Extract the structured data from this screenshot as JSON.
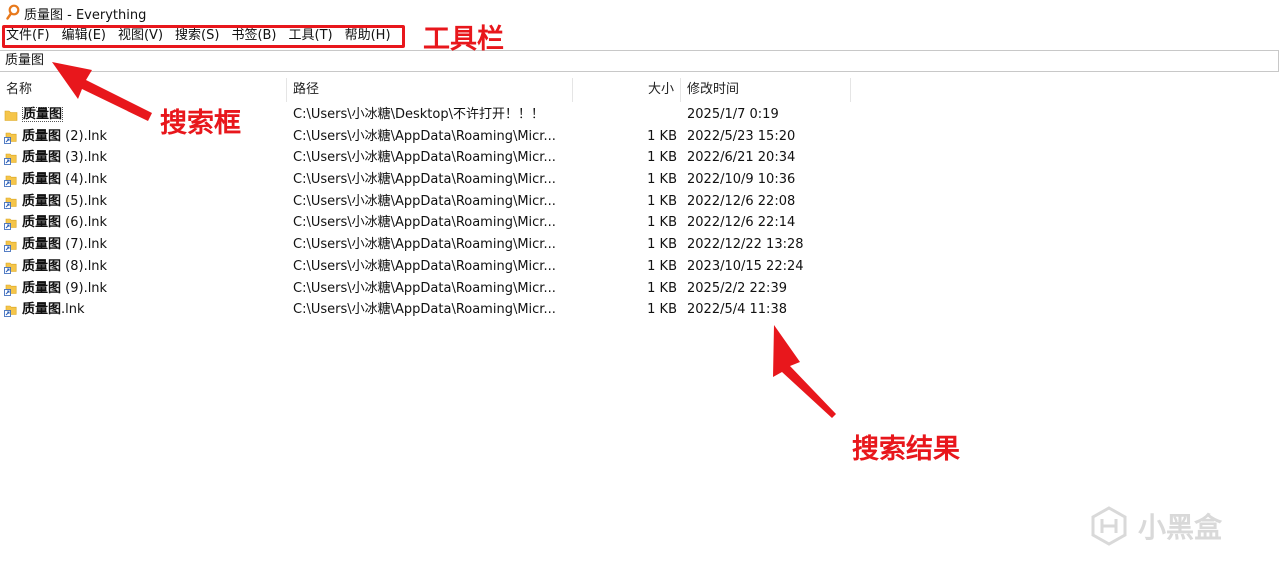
{
  "window": {
    "title": "质量图 - Everything",
    "app_icon": "everything-magnifier-icon"
  },
  "menu": [
    {
      "label": "文件(F)"
    },
    {
      "label": "编辑(E)"
    },
    {
      "label": "视图(V)"
    },
    {
      "label": "搜索(S)"
    },
    {
      "label": "书签(B)"
    },
    {
      "label": "工具(T)"
    },
    {
      "label": "帮助(H)"
    }
  ],
  "search": {
    "value": "质量图",
    "placeholder": ""
  },
  "columns": {
    "name": "名称",
    "path": "路径",
    "size": "大小",
    "modified": "修改时间"
  },
  "results": [
    {
      "icon": "folder-icon",
      "name_hl": "质量图",
      "name_rest": "",
      "path": "C:\\Users\\小冰糖\\Desktop\\不许打开！！！",
      "size": "",
      "modified": "2025/1/7 0:19",
      "selected": true
    },
    {
      "icon": "shortcut-icon",
      "name_hl": "质量图",
      "name_rest": " (2).lnk",
      "path": "C:\\Users\\小冰糖\\AppData\\Roaming\\Micr...",
      "size": "1 KB",
      "modified": "2022/5/23 15:20"
    },
    {
      "icon": "shortcut-icon",
      "name_hl": "质量图",
      "name_rest": " (3).lnk",
      "path": "C:\\Users\\小冰糖\\AppData\\Roaming\\Micr...",
      "size": "1 KB",
      "modified": "2022/6/21 20:34"
    },
    {
      "icon": "shortcut-icon",
      "name_hl": "质量图",
      "name_rest": " (4).lnk",
      "path": "C:\\Users\\小冰糖\\AppData\\Roaming\\Micr...",
      "size": "1 KB",
      "modified": "2022/10/9 10:36"
    },
    {
      "icon": "shortcut-icon",
      "name_hl": "质量图",
      "name_rest": " (5).lnk",
      "path": "C:\\Users\\小冰糖\\AppData\\Roaming\\Micr...",
      "size": "1 KB",
      "modified": "2022/12/6 22:08"
    },
    {
      "icon": "shortcut-icon",
      "name_hl": "质量图",
      "name_rest": " (6).lnk",
      "path": "C:\\Users\\小冰糖\\AppData\\Roaming\\Micr...",
      "size": "1 KB",
      "modified": "2022/12/6 22:14"
    },
    {
      "icon": "shortcut-icon",
      "name_hl": "质量图",
      "name_rest": " (7).lnk",
      "path": "C:\\Users\\小冰糖\\AppData\\Roaming\\Micr...",
      "size": "1 KB",
      "modified": "2022/12/22 13:28"
    },
    {
      "icon": "shortcut-icon",
      "name_hl": "质量图",
      "name_rest": " (8).lnk",
      "path": "C:\\Users\\小冰糖\\AppData\\Roaming\\Micr...",
      "size": "1 KB",
      "modified": "2023/10/15 22:24"
    },
    {
      "icon": "shortcut-icon",
      "name_hl": "质量图",
      "name_rest": " (9).lnk",
      "path": "C:\\Users\\小冰糖\\AppData\\Roaming\\Micr...",
      "size": "1 KB",
      "modified": "2025/2/2 22:39"
    },
    {
      "icon": "shortcut-icon",
      "name_hl": "质量图",
      "name_rest": ".lnk",
      "path": "C:\\Users\\小冰糖\\AppData\\Roaming\\Micr...",
      "size": "1 KB",
      "modified": "2022/5/4 11:38"
    }
  ],
  "annotations": {
    "toolbar": "工具栏",
    "search_box": "搜索框",
    "search_results": "搜索结果",
    "color": "#e8171c"
  },
  "watermark": {
    "text": "小黑盒",
    "icon": "xiaoheihe-logo-icon"
  }
}
